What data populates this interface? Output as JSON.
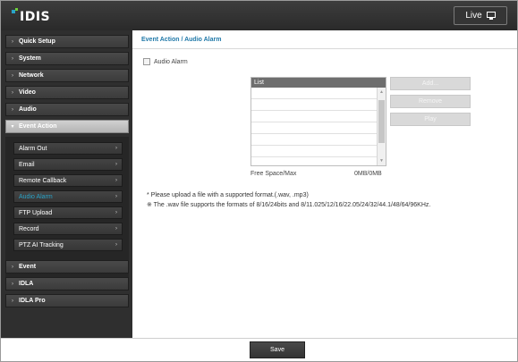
{
  "header": {
    "logo_text": "IDIS",
    "live_label": "Live",
    "colors": {
      "bar": "#2f2f2f",
      "logo_blue": "#2aa3c8",
      "logo_green": "#6fcf3a"
    }
  },
  "sidebar": {
    "items": [
      {
        "label": "Quick Setup"
      },
      {
        "label": "System"
      },
      {
        "label": "Network"
      },
      {
        "label": "Video"
      },
      {
        "label": "Audio"
      },
      {
        "label": "Event Action"
      },
      {
        "label": "Event"
      },
      {
        "label": "IDLA"
      },
      {
        "label": "IDLA Pro"
      }
    ],
    "submenu": [
      {
        "label": "Alarm Out"
      },
      {
        "label": "Email"
      },
      {
        "label": "Remote Callback"
      },
      {
        "label": "Audio Alarm"
      },
      {
        "label": "FTP Upload"
      },
      {
        "label": "Record"
      },
      {
        "label": "PTZ AI Tracking"
      }
    ],
    "active_item": "Event Action",
    "active_sub": "Audio Alarm",
    "accent_color": "#2aa3c8"
  },
  "content": {
    "breadcrumb": "Event Action / Audio Alarm",
    "audio_alarm_label": "Audio Alarm",
    "audio_alarm_checked": false,
    "list_header": "List",
    "buttons": {
      "add": "Add...",
      "remove": "Remove",
      "play": "Play"
    },
    "free_space_label": "Free Space/Max",
    "free_space_value": "0MB/0MB",
    "note1": "* Please upload a file with a supported format.(.wav, .mp3)",
    "note2": "※ The .wav file supports the formats of 8/16/24bits and 8/11.025/12/16/22.05/24/32/44.1/48/64/96KHz."
  },
  "footer": {
    "save_label": "Save"
  }
}
